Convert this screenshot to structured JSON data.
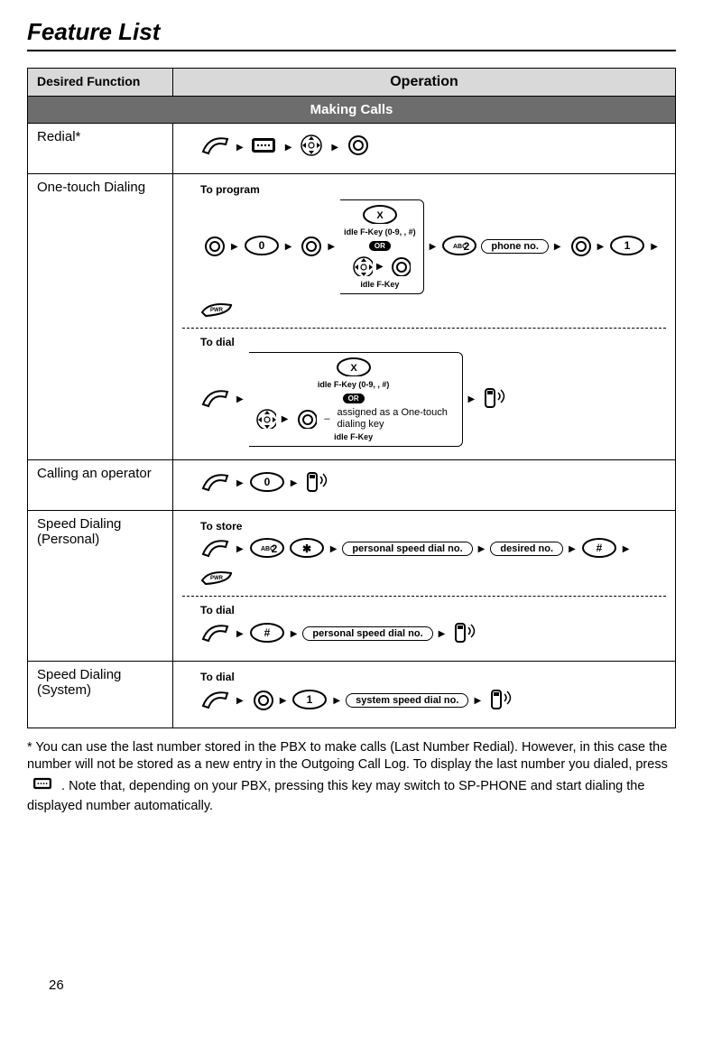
{
  "title": "Feature List",
  "header": {
    "left": "Desired Function",
    "right": "Operation"
  },
  "section1": "Making Calls",
  "rows": {
    "redial": {
      "label": "Redial*"
    },
    "onetouch": {
      "label": "One-touch Dialing",
      "program": "To program",
      "dial": "To dial",
      "idle_fkey_range": "idle F-Key (0-9, , #)",
      "idle_fkey": "idle F-Key",
      "or": "OR",
      "phone_no": "phone no.",
      "assigned_note": "assigned as a One-touch dialing key"
    },
    "operator": {
      "label": "Calling an operator"
    },
    "speed_personal": {
      "label": "Speed Dialing (Personal)",
      "store": "To store",
      "dial": "To dial",
      "personal_no": "personal speed dial no.",
      "desired_no": "desired no."
    },
    "speed_system": {
      "label": "Speed Dialing (System)",
      "dial": "To dial",
      "system_no": "system speed dial no."
    }
  },
  "footnote": {
    "text_a": "* You can use the last number stored in the PBX to make calls (Last Number Redial). However, in this case the number will not be stored as a new entry in the Outgoing Call Log. To display the last number you dialed, press ",
    "text_b": ". Note that, depending on your PBX, pressing this key may switch to SP-PHONE and start dialing the displayed number automatically."
  },
  "page_number": "26",
  "keys": {
    "X": "X",
    "zero": "0",
    "one": "1",
    "two": "2",
    "hash": "#",
    "star": "✱"
  }
}
